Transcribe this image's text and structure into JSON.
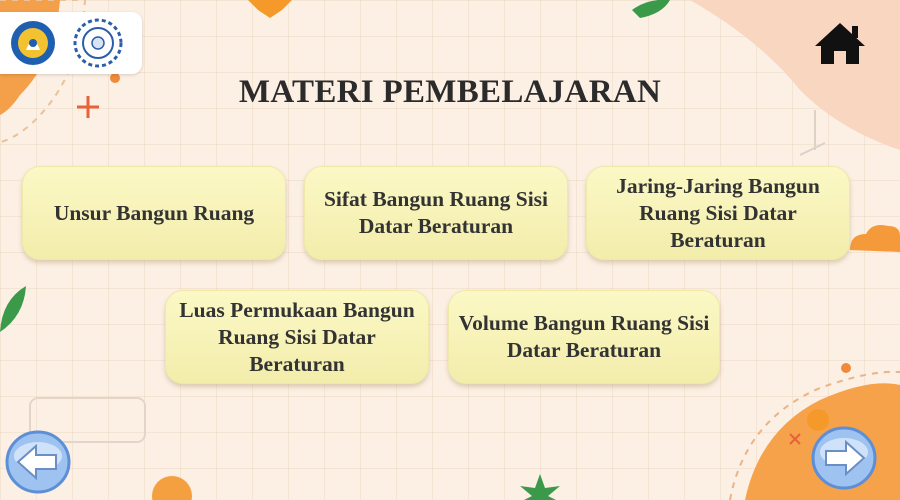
{
  "page": {
    "title": "MATERI PEMBELAJARAN"
  },
  "menu": {
    "items": [
      {
        "id": "unsur",
        "label": "Unsur Bangun Ruang"
      },
      {
        "id": "sifat",
        "label": "Sifat Bangun Ruang Sisi Datar Beraturan"
      },
      {
        "id": "jaring",
        "label": "Jaring-Jaring Bangun Ruang Sisi Datar Beraturan"
      },
      {
        "id": "luas",
        "label": "Luas Permukaan Bangun Ruang Sisi Datar Beraturan"
      },
      {
        "id": "volume",
        "label": "Volume Bangun Ruang Sisi Datar Beraturan"
      }
    ]
  },
  "icons": {
    "home": "home-icon",
    "back": "arrow-left-icon",
    "next": "arrow-right-icon",
    "logo_left": "tut-wuri-handayani-logo",
    "logo_right": "university-seal-logo"
  },
  "colors": {
    "button_fill": "#f8f4b8",
    "nav_button": "#6aa0e8",
    "accent_orange": "#f59a3a",
    "leaf_green": "#3a9a4a"
  }
}
